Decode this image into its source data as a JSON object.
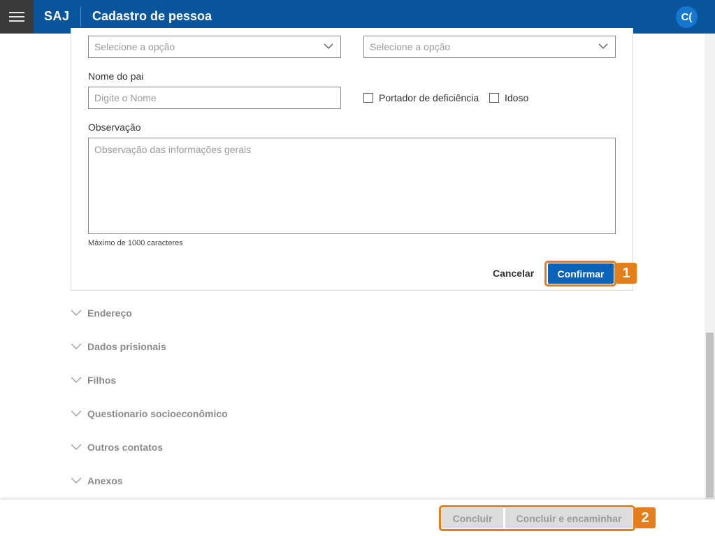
{
  "header": {
    "brand": "SAJ",
    "title": "Cadastro de pessoa",
    "avatar_initials": "C("
  },
  "form": {
    "select1_placeholder": "Selecione a opção",
    "select2_placeholder": "Selecione a opção",
    "nome_pai_label": "Nome do pai",
    "nome_pai_placeholder": "Digite o Nome",
    "portador_label": "Portador de deficiência",
    "idoso_label": "Idoso",
    "observacao_label": "Observação",
    "observacao_placeholder": "Observação das informações gerais",
    "max_chars_hint": "Máximo de 1000 caracteres",
    "cancel_label": "Cancelar",
    "confirm_label": "Confirmar",
    "callout_1": "1"
  },
  "sections": [
    {
      "label": "Endereço"
    },
    {
      "label": "Dados prisionais"
    },
    {
      "label": "Filhos"
    },
    {
      "label": "Questionario socioeconômico"
    },
    {
      "label": "Outros contatos"
    },
    {
      "label": "Anexos"
    }
  ],
  "footer": {
    "concluir_label": "Concluir",
    "concluir_encaminhar_label": "Concluir e encaminhar",
    "callout_2": "2"
  },
  "colors": {
    "header_bg": "#0a569c",
    "accent_blue": "#0a63b8",
    "callout_orange": "#e37e1a"
  }
}
